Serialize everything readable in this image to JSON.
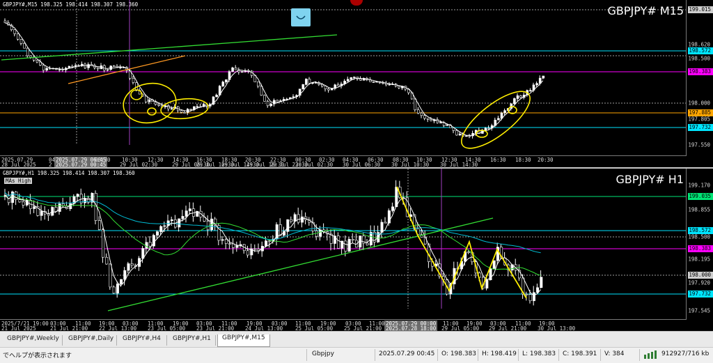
{
  "charts": [
    {
      "id": "m15",
      "info": "GBPJPY#,M15 198.325 198.414 198.307 198.360",
      "title": "GBPJPY# M15",
      "y_ticks": [
        "199.015",
        "198.620",
        "198.500",
        "198.383",
        "198.000",
        "197.805",
        "197.550"
      ],
      "y_badges": [
        {
          "text": "199.015",
          "bg": "#cfcfcf"
        },
        {
          "text": "198.572",
          "bg": "#00e5ff"
        },
        {
          "text": "198.383",
          "bg": "#ff00ff"
        },
        {
          "text": "197.885",
          "bg": "#ffa500"
        },
        {
          "text": "197.732",
          "bg": "#00e5ff"
        }
      ],
      "x_row1": [
        "2025.07.29",
        "04:",
        "2025.07.29 06:45",
        "08:30",
        "10:30",
        "12:30",
        "14:30",
        "16:30",
        "18:30",
        "20:30",
        "22:30",
        "00:30",
        "02:30",
        "04:30",
        "06:30",
        "08:30",
        "10:30",
        "12:30",
        "14:30",
        "16:30",
        "18:30",
        "20:30"
      ],
      "x_row2": [
        "28 Jul 2025",
        "2",
        "2025.07.29 00:45",
        "29 Jul 02:30",
        "29 Jul 06:30",
        "29 Jul 10:30",
        "29 Jul 14:30",
        "29 Jul 18:30",
        "29 Jul 22:30",
        "30 Jul 02:30",
        "30 Jul 06:30",
        "30 Jul 10:30",
        "30 Jul 14:30"
      ]
    },
    {
      "id": "h1",
      "info": "GBPJPY#,H1 198.325 198.414 198.307 198.360",
      "title": "GBPJPY# H1",
      "indicator_label": "MAs High",
      "y_ticks": [
        "199.170",
        "198.855",
        "198.500",
        "198.195",
        "198.000",
        "197.920",
        "197.545"
      ],
      "y_badges": [
        {
          "text": "199.035",
          "bg": "#00e676"
        },
        {
          "text": "198.572",
          "bg": "#00e5ff"
        },
        {
          "text": "198.383",
          "bg": "#ff00ff"
        },
        {
          "text": "198.000",
          "bg": "#cfcfcf"
        },
        {
          "text": "197.732",
          "bg": "#00e5ff"
        }
      ],
      "x_row1": [
        "2025/7/21 19:00",
        "03:00",
        "11:00",
        "19:00",
        "03:00",
        "11:00",
        "19:00",
        "03:00",
        "11:00",
        "19:00",
        "03:00",
        "11:00",
        "19:00",
        "03:00",
        "11:00",
        "2025.07.29 00:00",
        "11:00",
        "19:00",
        "03:00",
        "11:00",
        "19:00"
      ],
      "x_row2": [
        "21 Jul 2025",
        "21 Jul 21:00",
        "22 Jul 13:00",
        "23 Jul 05:00",
        "23 Jul 21:00",
        "24 Jul 13:00",
        "25 Jul 05:00",
        "25 Jul 21:00",
        "2025.07.28 18:00",
        "29 Jul 05:00",
        "29 Jul 21:00",
        "30 Jul 13:00"
      ]
    }
  ],
  "tabs": [
    {
      "label": "GBPJPY#,Weekly",
      "active": false
    },
    {
      "label": "GBPJPY#,Daily",
      "active": false
    },
    {
      "label": "GBPJPY#,H4",
      "active": false
    },
    {
      "label": "GBPJPY#,H1",
      "active": false
    },
    {
      "label": "GBPJPY#,M15",
      "active": true
    }
  ],
  "status": {
    "help": "でヘルプが表示されます",
    "symbol": "Gbpjpy",
    "time": "2025.07.29 00:45",
    "open": "O: 198.383",
    "high": "H: 198.419",
    "low": "L: 198.383",
    "close": "C: 198.391",
    "volume": "V: 384",
    "traffic": "912927/716 kb"
  },
  "icons": {
    "phone": "phone-icon",
    "connection": "connection-bars-icon"
  }
}
